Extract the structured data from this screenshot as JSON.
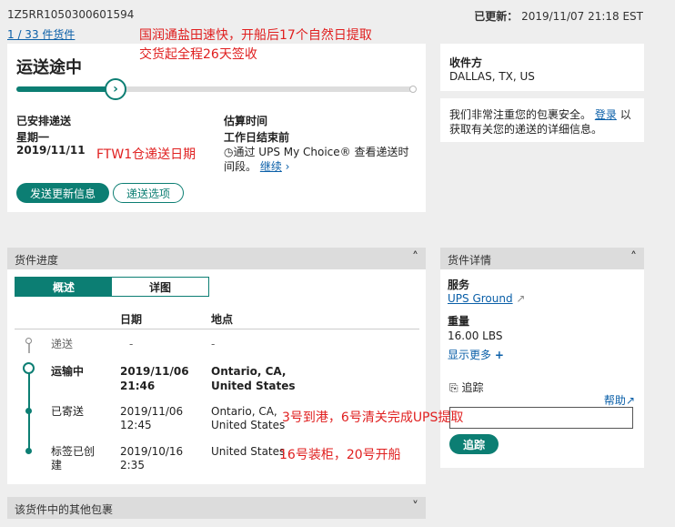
{
  "header": {
    "tracking_number": "1Z5RR1050300601594",
    "package_count_link": "1 / 33 件货件",
    "updated_label": "已更新：",
    "updated_value": "2019/11/07 21:18 EST"
  },
  "status_card": {
    "title": "运送途中",
    "progress_fraction": 0.25,
    "scheduled_label": "已安排递送",
    "scheduled_day": "星期一",
    "scheduled_date": "2019/11/11",
    "estimated_label": "估算时间",
    "estimated_value": "工作日结束前",
    "estimated_note": "通过 UPS My Choice® 查看递送时间段。",
    "continue_link": "继续",
    "send_updates_button": "发送更新信息",
    "delivery_options_button": "递送选项"
  },
  "recipient_card": {
    "label": "收件方",
    "value": "DALLAS, TX, US"
  },
  "security_card": {
    "text_before": "我们非常注重您的包裹安全。",
    "login_link": "登录",
    "text_after": "以获取有关您的递送的详细信息。"
  },
  "progress_panel": {
    "title": "货件进度",
    "tab_overview": "概述",
    "tab_detail": "详图",
    "col_date": "日期",
    "col_location": "地点",
    "rows": [
      {
        "status": "递送",
        "date": "-",
        "location": "-"
      },
      {
        "status": "运输中",
        "date_line1": "2019/11/06",
        "date_line2": "21:46",
        "loc_line1": "Ontario, CA,",
        "loc_line2": "United States"
      },
      {
        "status": "已寄送",
        "date_line1": "2019/11/06",
        "date_line2": "12:45",
        "loc_line1": "Ontario, CA,",
        "loc_line2": "United States"
      },
      {
        "status_line1": "标签已创",
        "status_line2": "建",
        "date_line1": "2019/10/16",
        "date_line2": "2:35",
        "loc_line1": "United States"
      }
    ]
  },
  "detail_panel": {
    "title": "货件详情",
    "service_label": "服务",
    "service_value": "UPS Ground",
    "weight_label": "重量",
    "weight_value": "16.00 LBS",
    "show_more": "显示更多"
  },
  "track_card": {
    "title": "追踪",
    "help_link": "帮助",
    "input_value": "",
    "track_button": "追踪"
  },
  "other_packages_panel": {
    "title": "该货件中的其他包裹"
  },
  "annotations": {
    "note1_line1": "国润通盐田速快，开船后17个自然日提取",
    "note1_line2": "交货起全程26天签收",
    "note2": "FTW1仓递送日期",
    "note3": "3号到港，6号清关完成UPS提取",
    "note4": "16号装柜，20号开船"
  },
  "colors": {
    "accent": "#0c7e73",
    "link": "#0a5fa8",
    "annotation": "#e02020"
  }
}
